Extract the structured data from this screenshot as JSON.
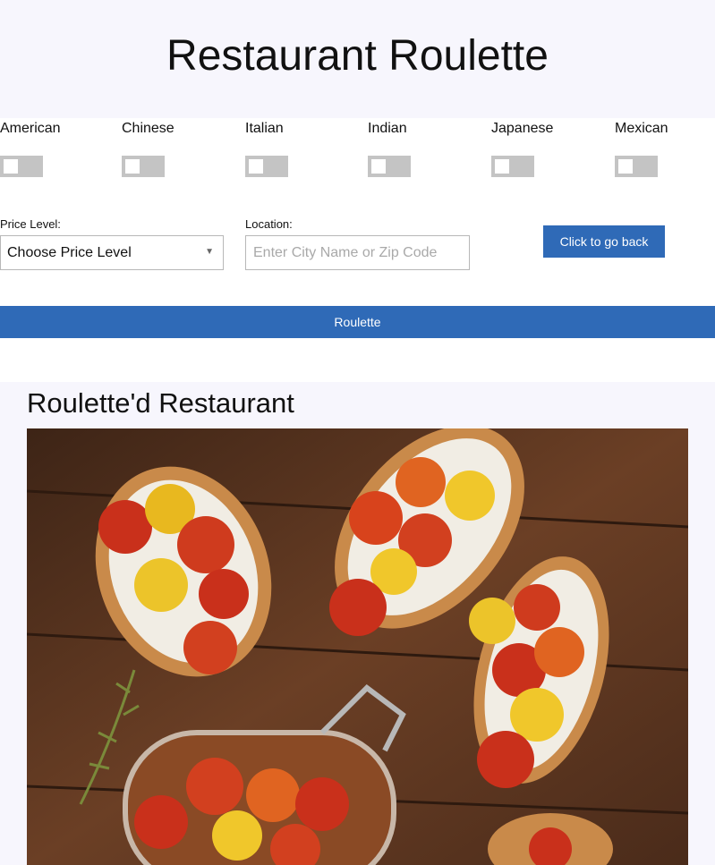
{
  "header": {
    "title": "Restaurant Roulette"
  },
  "cuisines": [
    {
      "label": "American",
      "checked": false
    },
    {
      "label": "Chinese",
      "checked": false
    },
    {
      "label": "Italian",
      "checked": false
    },
    {
      "label": "Indian",
      "checked": false
    },
    {
      "label": "Japanese",
      "checked": false
    },
    {
      "label": "Mexican",
      "checked": false
    }
  ],
  "price": {
    "label": "Price Level:",
    "selected": "Choose Price Level"
  },
  "location": {
    "label": "Location:",
    "placeholder": "Enter City Name or Zip Code",
    "value": ""
  },
  "buttons": {
    "back": "Click to go back",
    "roulette": "Roulette"
  },
  "result": {
    "title": "Roulette'd Restaurant",
    "image_icon": "food-photo"
  },
  "colors": {
    "accent": "#2f6ab7",
    "band": "#f7f6fd",
    "toggle_off": "#c4c4c4"
  }
}
